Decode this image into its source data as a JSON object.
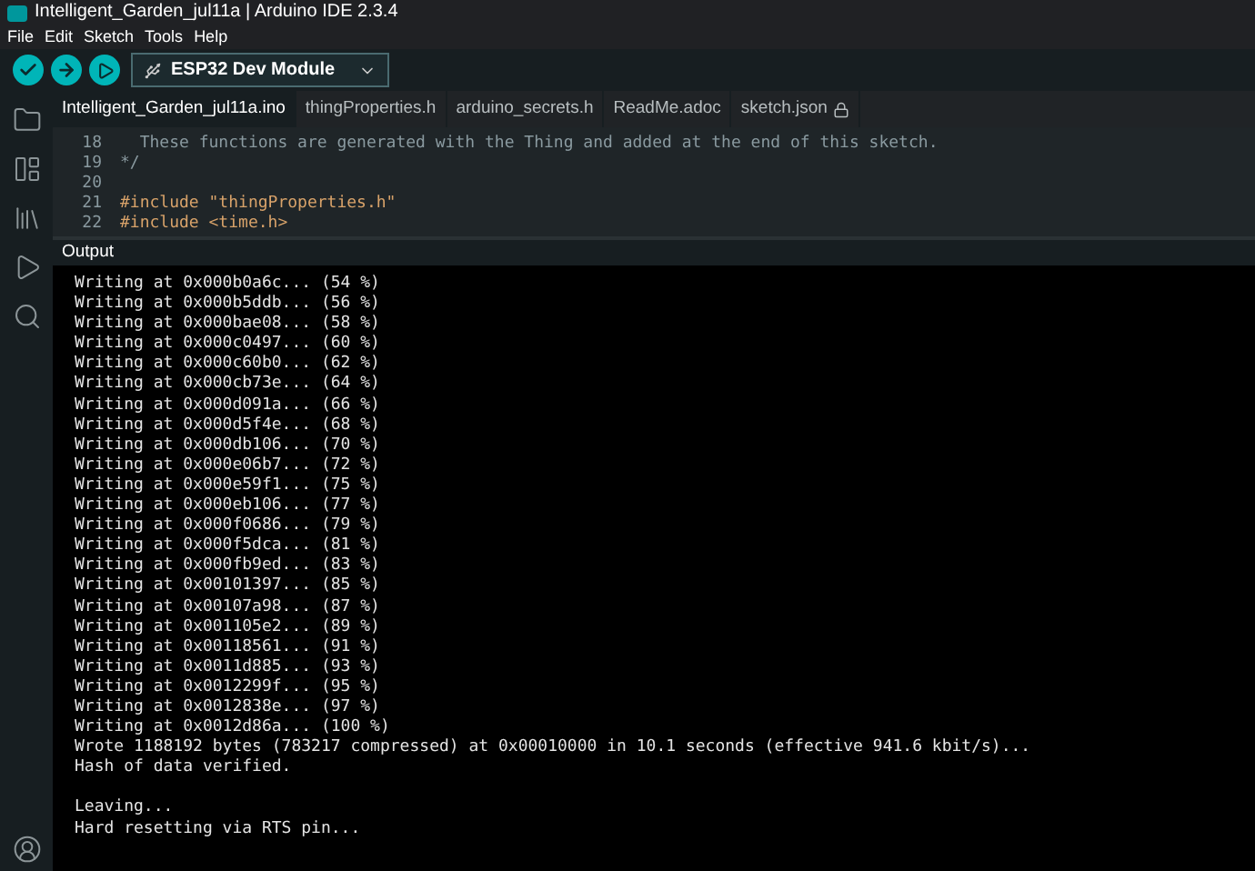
{
  "window": {
    "title": "Intelligent_Garden_jul11a | Arduino IDE 2.3.4"
  },
  "menu": [
    "File",
    "Edit",
    "Sketch",
    "Tools",
    "Help"
  ],
  "toolbar": {
    "board": "ESP32 Dev Module"
  },
  "tabs": [
    {
      "label": "Intelligent_Garden_jul11a.ino",
      "selected": true,
      "locked": false
    },
    {
      "label": "thingProperties.h",
      "selected": false,
      "locked": false
    },
    {
      "label": "arduino_secrets.h",
      "selected": false,
      "locked": false
    },
    {
      "label": "ReadMe.adoc",
      "selected": false,
      "locked": false
    },
    {
      "label": "sketch.json",
      "selected": false,
      "locked": true
    }
  ],
  "editor": {
    "lines": [
      {
        "number": "18",
        "text": "  These functions are generated with the Thing and added at the end of this sketch.",
        "kind": "comment"
      },
      {
        "number": "19",
        "text": "*/",
        "kind": "comment"
      },
      {
        "number": "20"
      },
      {
        "number": "21",
        "text": "#include \"thingProperties.h\"",
        "kind": "directive"
      },
      {
        "number": "22",
        "text": "#include <time.h>",
        "kind": "directive"
      }
    ]
  },
  "output": {
    "title": "Output",
    "blocks": [
      [
        "Writing at 0x000b0a6c... (54 %)",
        "Writing at 0x000b5ddb... (56 %)",
        "Writing at 0x000bae08... (58 %)",
        "Writing at 0x000c0497... (60 %)",
        "Writing at 0x000c60b0... (62 %)",
        "Writing at 0x000cb73e... (64 %)",
        "Writing at 0x000d091a... (66 %)",
        "Writing at 0x000d5f4e... (68 %)",
        "Writing at 0x000db106... (70 %)",
        "Writing at 0x000e06b7... (72 %)",
        "Writing at 0x000e59f1... (75 %)",
        "Writing at 0x000eb106... (77 %)",
        "Writing at 0x000f0686... (79 %)",
        "Writing at 0x000f5dca... (81 %)",
        "Writing at 0x000fb9ed... (83 %)",
        "Writing at 0x00101397... (85 %)",
        "Writing at 0x00107a98... (87 %)",
        "Writing at 0x001105e2... (89 %)",
        "Writing at 0x00118561... (91 %)",
        "Writing at 0x0011d885... (93 %)",
        "Writing at 0x0012299f... (95 %)",
        "Writing at 0x0012838e... (97 %)",
        "Writing at 0x0012d86a... (100 %)",
        "Wrote 1188192 bytes (783217 compressed) at 0x00010000 in 10.1 seconds (effective 941.6 kbit/s)...",
        "Hash of data verified."
      ],
      [
        "Leaving...",
        "Hard resetting via RTS pin..."
      ]
    ]
  }
}
